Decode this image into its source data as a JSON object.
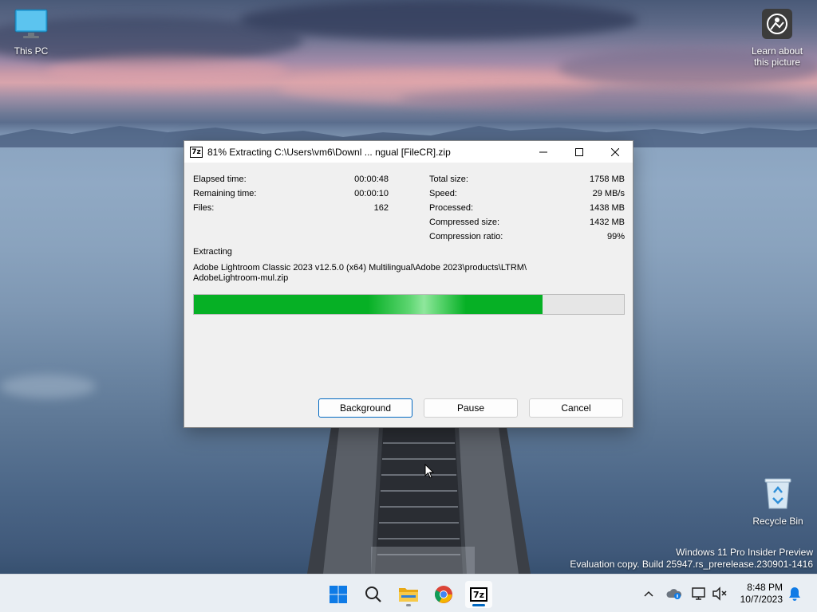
{
  "desktop": {
    "this_pc_label": "This PC",
    "learn_label_line1": "Learn about",
    "learn_label_line2": "this picture",
    "recycle_bin_label": "Recycle Bin",
    "watermark_line1": "Windows 11 Pro Insider Preview",
    "watermark_line2": "Evaluation copy. Build 25947.rs_prerelease.230901-1416"
  },
  "window": {
    "app_icon_text": "7z",
    "title": "81% Extracting C:\\Users\\vm6\\Downl ... ngual [FileCR].zip",
    "left_stats": [
      {
        "label": "Elapsed time:",
        "value": "00:00:48"
      },
      {
        "label": "Remaining time:",
        "value": "00:00:10"
      },
      {
        "label": "Files:",
        "value": "162"
      }
    ],
    "right_stats": [
      {
        "label": "Total size:",
        "value": "1758 MB"
      },
      {
        "label": "Speed:",
        "value": "29 MB/s"
      },
      {
        "label": "Processed:",
        "value": "1438 MB"
      },
      {
        "label": "Compressed size:",
        "value": "1432 MB"
      },
      {
        "label": "Compression ratio:",
        "value": "99%"
      }
    ],
    "section_label": "Extracting",
    "file_path_line1": "Adobe Lightroom Classic 2023 v12.5.0 (x64) Multilingual\\Adobe 2023\\products\\LTRM\\",
    "file_path_line2": "AdobeLightroom-mul.zip",
    "progress_percent": 81,
    "buttons": {
      "background": "Background",
      "pause": "Pause",
      "cancel": "Cancel"
    }
  },
  "taskbar": {
    "apps": [
      "start-icon",
      "search-icon",
      "file-explorer-icon",
      "chrome-icon",
      "7zip-icon"
    ],
    "time": "8:48 PM",
    "date": "10/7/2023",
    "tray_app_icon_text": "7z"
  },
  "colors": {
    "progress": "#06b025",
    "accent": "#0067c0",
    "taskbar": "#e9eef3"
  }
}
